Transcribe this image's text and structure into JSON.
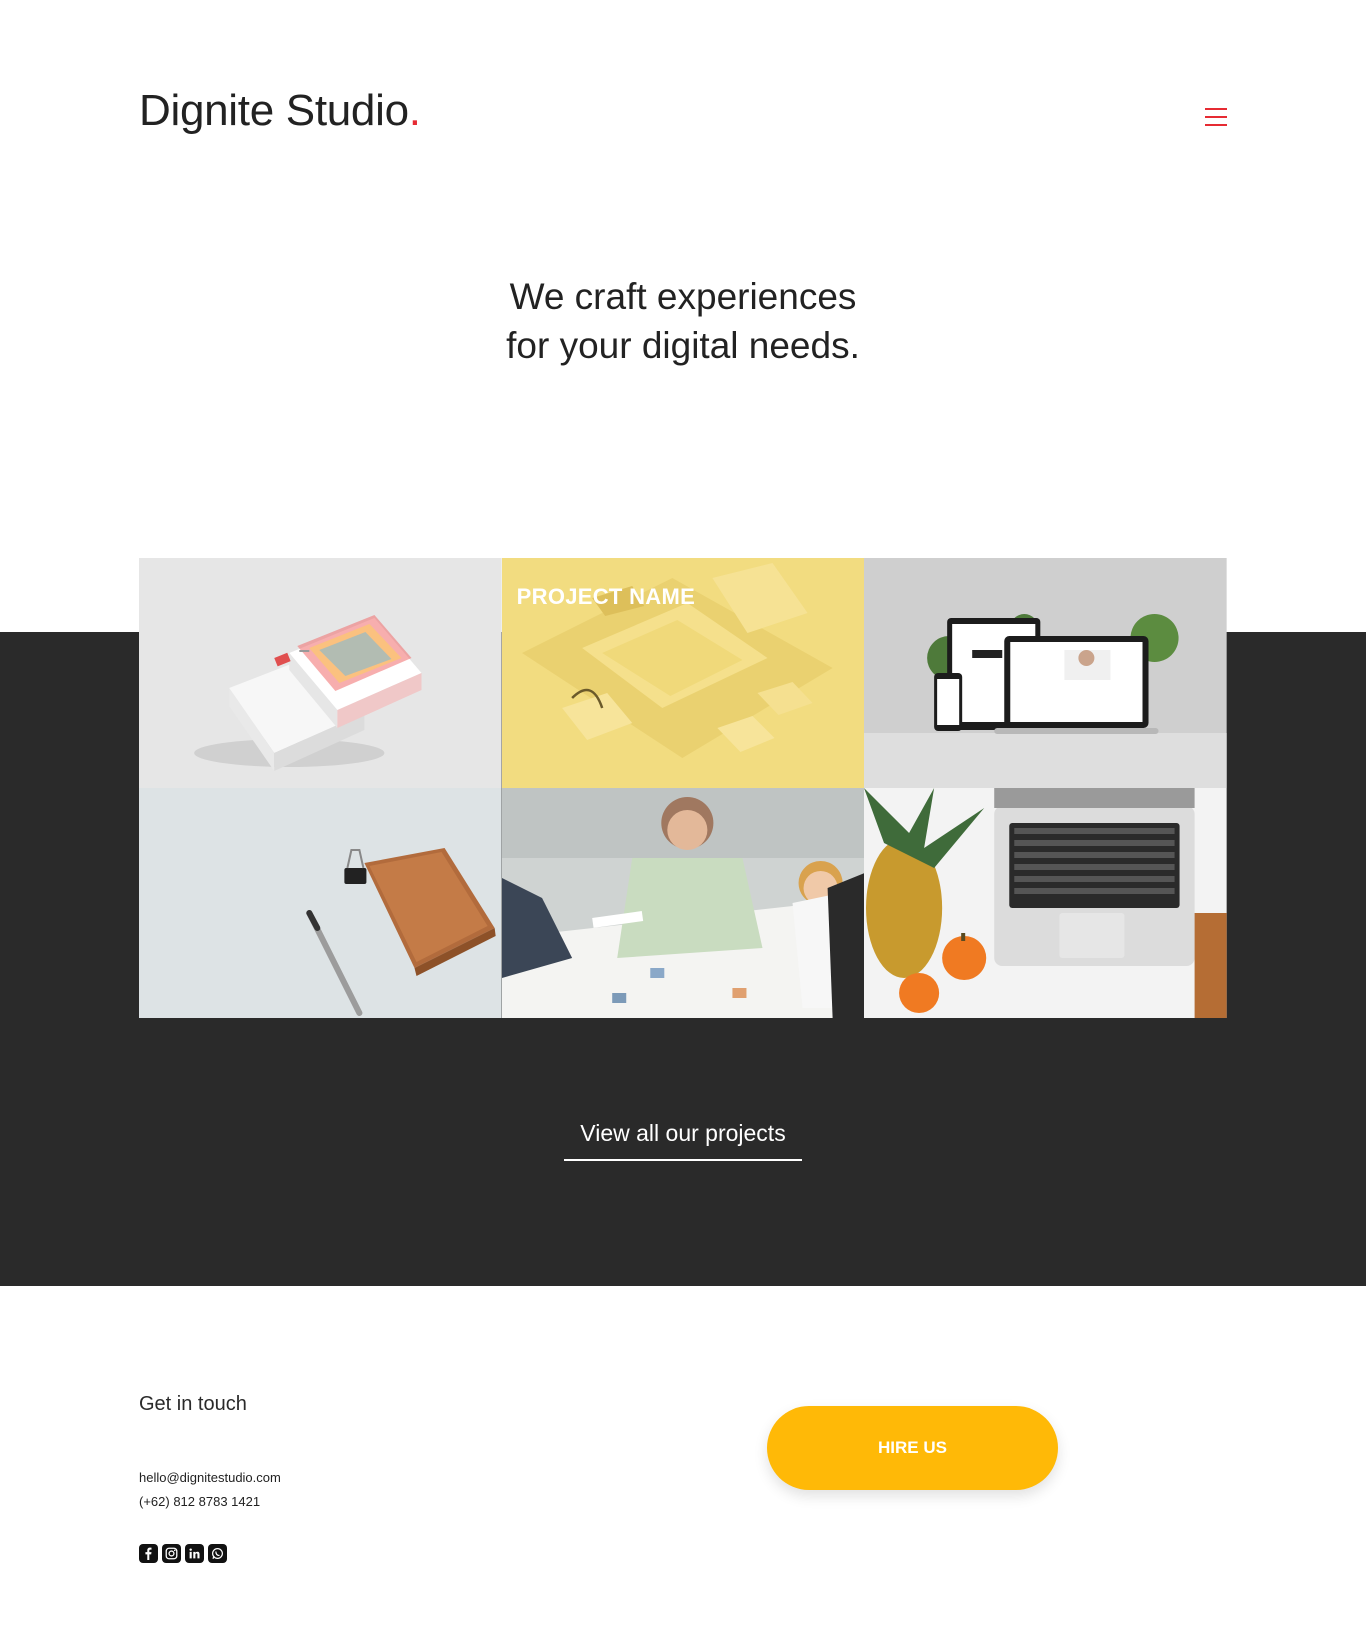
{
  "header": {
    "logo_text": "Dignite Studio",
    "logo_dot": ".",
    "menu_icon": "hamburger-menu-icon"
  },
  "hero": {
    "line1": "We craft experiences",
    "line2": "for your digital needs."
  },
  "projects": {
    "tiles": [
      {
        "name": "business-cards",
        "title": ""
      },
      {
        "name": "yellow-merch",
        "title": "PROJECT NAME"
      },
      {
        "name": "responsive-devices",
        "title": ""
      },
      {
        "name": "notebook-pen",
        "title": ""
      },
      {
        "name": "team-meeting",
        "title": ""
      },
      {
        "name": "laptop-fruits",
        "title": ""
      }
    ],
    "view_all_label": "View all our projects"
  },
  "footer": {
    "contact_title": "Get in touch",
    "email": "hello@dignitestudio.com",
    "phone": "(+62) 812 8783 1421",
    "socials": [
      "facebook-icon",
      "instagram-icon",
      "linkedin-icon",
      "whatsapp-icon"
    ],
    "hire_label": "HIRE US"
  },
  "colors": {
    "accent": "#e62b33",
    "dark": "#2a2a2a",
    "hire": "#ffb907",
    "yellow_tile": "#f2dc80"
  }
}
